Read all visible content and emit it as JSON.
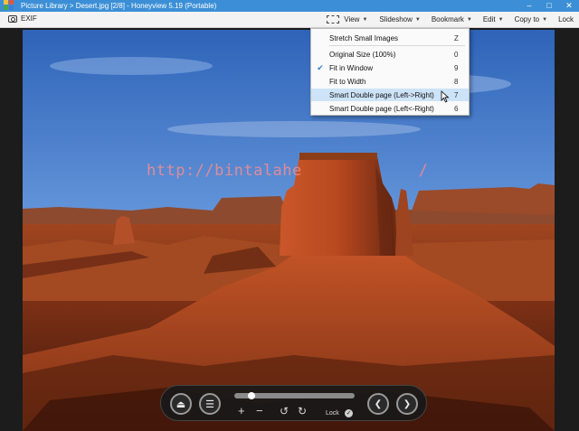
{
  "window": {
    "title": "Picture Library > Desert.jpg [2/8] - Honeyview 5.19 (Portable)",
    "controls": [
      "–",
      "□",
      "✕"
    ]
  },
  "toolbar": {
    "exif_label": "EXIF",
    "menus": [
      {
        "label": "View",
        "icon": "view-mode-icon"
      },
      {
        "label": "Slideshow"
      },
      {
        "label": "Bookmark"
      },
      {
        "label": "Edit"
      },
      {
        "label": "Copy to"
      },
      {
        "label": "Lock"
      }
    ],
    "caret": "▼"
  },
  "watermark": "http://bintalahe",
  "watermark_tail": "/",
  "view_menu": {
    "items": [
      {
        "label": "Stretch Small Images",
        "key": "Z",
        "checked": false,
        "highlighted": false
      },
      {
        "label": "Original Size (100%)",
        "key": "0",
        "checked": false,
        "highlighted": false
      },
      {
        "label": "Fit in Window",
        "key": "9",
        "checked": true,
        "highlighted": false
      },
      {
        "label": "Fit to Width",
        "key": "8",
        "checked": false,
        "highlighted": false
      },
      {
        "label": "Smart Double page (Left->Right)",
        "key": "7",
        "checked": false,
        "highlighted": true
      },
      {
        "label": "Smart Double page (Left<-Right)",
        "key": "6",
        "checked": false,
        "highlighted": false
      }
    ],
    "check_glyph": "✔"
  },
  "controls": {
    "eject": "⏏",
    "menu": "☰",
    "zoom_in": "+",
    "zoom_out": "−",
    "rotate_left": "↺",
    "rotate_right": "↻",
    "lock_label": "Lock",
    "lock_check": "✓",
    "prev": "❮",
    "next": "❯",
    "progress": 0.14
  },
  "colors": {
    "titlebar": "#3c8fd6",
    "highlight": "#cde3f7",
    "check": "#2f7fd1"
  }
}
